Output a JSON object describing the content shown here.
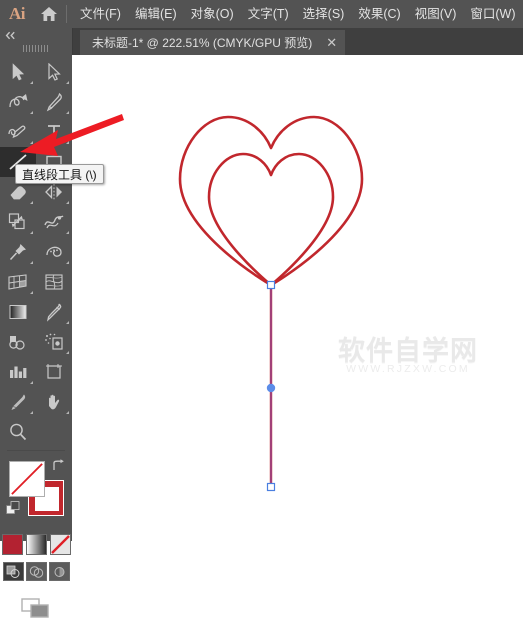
{
  "app": {
    "name": "Ai",
    "logo_color": "#d9a382",
    "chrome_bg": "#535353"
  },
  "menubar": {
    "home_icon": "home-icon",
    "items": [
      {
        "label": "文件(F)"
      },
      {
        "label": "编辑(E)"
      },
      {
        "label": "对象(O)"
      },
      {
        "label": "文字(T)"
      },
      {
        "label": "选择(S)"
      },
      {
        "label": "效果(C)"
      },
      {
        "label": "视图(V)"
      },
      {
        "label": "窗口(W)"
      }
    ]
  },
  "tabbar": {
    "tab_title": "未标题-1* @ 222.51% (CMYK/GPU 预览)",
    "close_glyph": "✕"
  },
  "toolpanel": {
    "collapse_icon": "double-chevron-left-icon",
    "tools": [
      {
        "name": "selection-tool",
        "icon": "arrow-cursor-icon",
        "has_flyout": true
      },
      {
        "name": "direct-selection-tool",
        "icon": "white-arrow-cursor-icon",
        "has_flyout": true
      },
      {
        "name": "curvature-tool",
        "icon": "curvature-icon",
        "has_flyout": true
      },
      {
        "name": "pen-tool",
        "icon": "pen-nib-icon",
        "has_flyout": true
      },
      {
        "name": "shaper-tool",
        "icon": "shaper-icon",
        "has_flyout": true
      },
      {
        "name": "type-tool",
        "icon": "type-T-icon",
        "has_flyout": true
      },
      {
        "name": "line-segment-tool",
        "icon": "diagonal-line-icon",
        "has_flyout": true,
        "selected": true
      },
      {
        "name": "rectangle-tool",
        "icon": "rectangle-icon",
        "has_flyout": true
      },
      {
        "name": "eraser-tool",
        "icon": "eraser-icon",
        "has_flyout": true
      },
      {
        "name": "rotate-tool",
        "icon": "rotate-reflect-icon",
        "has_flyout": true
      },
      {
        "name": "scale-tool",
        "icon": "scale-arrow-icon",
        "has_flyout": true
      },
      {
        "name": "width-tool",
        "icon": "warp-icon",
        "has_flyout": true
      },
      {
        "name": "free-transform-tool",
        "icon": "pushpin-icon",
        "has_flyout": true
      },
      {
        "name": "shape-builder-tool",
        "icon": "shape-builder-icon",
        "has_flyout": true
      },
      {
        "name": "perspective-grid-tool",
        "icon": "perspective-grid-icon",
        "has_flyout": true
      },
      {
        "name": "mesh-tool",
        "icon": "mesh-icon",
        "has_flyout": false
      },
      {
        "name": "gradient-tool",
        "icon": "gradient-icon",
        "has_flyout": false
      },
      {
        "name": "eyedropper-tool",
        "icon": "eyedropper-icon",
        "has_flyout": true
      },
      {
        "name": "blend-tool",
        "icon": "blend-icon",
        "has_flyout": false
      },
      {
        "name": "symbol-sprayer-tool",
        "icon": "symbol-sprayer-icon",
        "has_flyout": true
      },
      {
        "name": "column-graph-tool",
        "icon": "bar-chart-icon",
        "has_flyout": true
      },
      {
        "name": "artboard-tool",
        "icon": "artboard-icon",
        "has_flyout": false
      },
      {
        "name": "slice-tool",
        "icon": "knife-icon",
        "has_flyout": true
      },
      {
        "name": "hand-tool",
        "icon": "hand-icon",
        "has_flyout": true
      },
      {
        "name": "zoom-tool",
        "icon": "magnifier-icon",
        "has_flyout": false
      }
    ]
  },
  "tooltip": {
    "label": "直线段工具 (\\)",
    "visible": true
  },
  "colors": {
    "fill": {
      "name": "fill-swatch",
      "value": "none",
      "display": "#ffffff"
    },
    "stroke": {
      "name": "stroke-swatch",
      "value": "#c1272d"
    },
    "swap_icon": "swap-fill-stroke-icon",
    "default_icon": "default-fill-stroke-icon",
    "mode_buttons": [
      {
        "name": "color-mode-button",
        "icon": "solid-color-icon",
        "color": "#b32231",
        "active": false
      },
      {
        "name": "gradient-mode-button",
        "icon": "gradient-icon",
        "active": false
      },
      {
        "name": "none-mode-button",
        "icon": "none-slash-icon",
        "active": true
      }
    ],
    "draw_modes": [
      {
        "name": "draw-normal-button",
        "icon": "draw-normal-icon",
        "active": true
      },
      {
        "name": "draw-behind-button",
        "icon": "draw-behind-icon",
        "active": false
      },
      {
        "name": "draw-inside-button",
        "icon": "draw-inside-icon",
        "active": false
      }
    ],
    "screen_mode": {
      "name": "change-screen-mode-button",
      "icon": "screen-mode-icon"
    }
  },
  "canvas": {
    "artwork": {
      "stroke_color": "#c1272d",
      "shapes": [
        {
          "name": "outer-heart-path",
          "type": "heart"
        },
        {
          "name": "inner-heart-path",
          "type": "heart"
        },
        {
          "name": "stem-line-path",
          "type": "line"
        }
      ],
      "anchor_color": "#4a7fe0",
      "selection_path_color": "#7b5fd4"
    },
    "watermark": {
      "main": "软件自学网",
      "sub": "WWW.RJZXW.COM"
    },
    "annotation": {
      "name": "red-pointer-arrow",
      "color": "#ed1c24"
    }
  }
}
